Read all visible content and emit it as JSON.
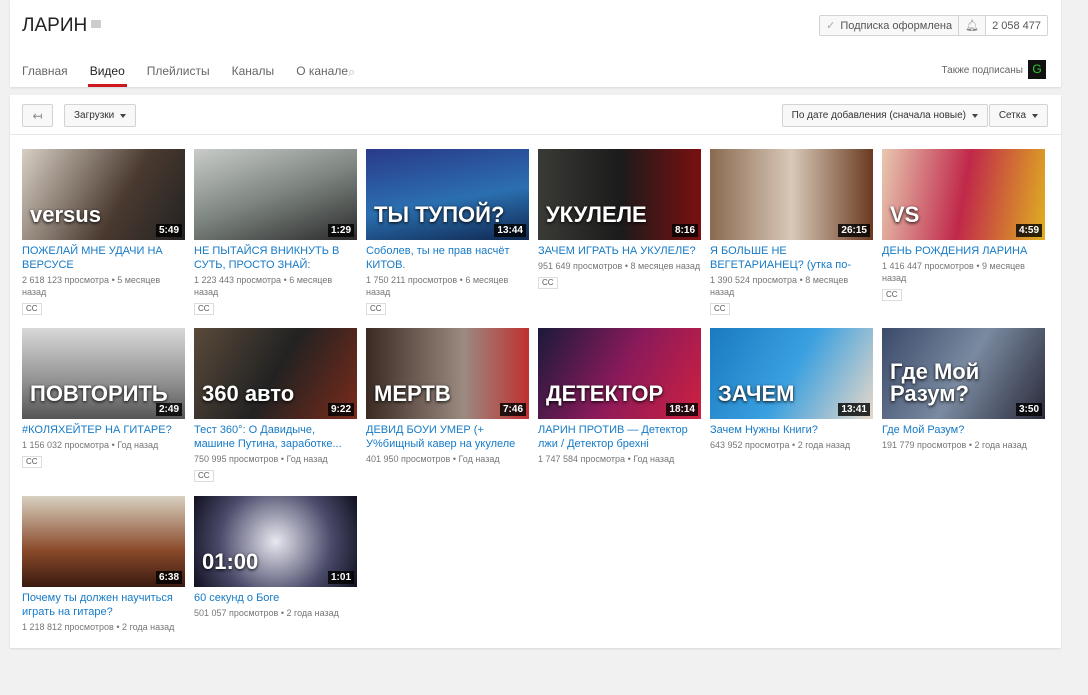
{
  "channel": {
    "title": "ЛАРИН",
    "subscribed_label": "Подписка оформлена",
    "subscriber_count": "2 058 477",
    "also_subscribed": "Также подписаны",
    "also_avatar": "G"
  },
  "tabs": [
    "Главная",
    "Видео",
    "Плейлисты",
    "Каналы",
    "О канале"
  ],
  "toolbar": {
    "uploads": "Загрузки",
    "sort": "По дате добавления (сначала новые)",
    "view": "Сетка"
  },
  "rows": [
    [
      {
        "title": "ПОЖЕЛАЙ МНЕ УДАЧИ НА ВЕРСУСЕ",
        "views": "2 618 123 просмотра",
        "date": "5 месяцев назад",
        "duration": "5:49",
        "cc": "CC",
        "thumb_text": "versus",
        "bg": "linear-gradient(120deg,#d8cfc4,#4a3a30 60%,#222)"
      },
      {
        "title": "НЕ ПЫТАЙСЯ ВНИКНУТЬ В СУТЬ, ПРОСТО ЗНАЙ:",
        "views": "1 223 443 просмотра",
        "date": "6 месяцев назад",
        "duration": "1:29",
        "cc": "CC",
        "thumb_text": "",
        "bg": "linear-gradient(160deg,#c9ccc9,#7d8580 50%,#2a2a2a)"
      },
      {
        "title": "Соболев, ты не прав насчёт КИТОВ.",
        "views": "1 750 211 просмотров",
        "date": "6 месяцев назад",
        "duration": "13:44",
        "cc": "CC",
        "thumb_text": "ТЫ ТУПОЙ?",
        "bg": "linear-gradient(170deg,#2a3a8a,#2b6fb0 55%,#0f2850)"
      },
      {
        "title": "ЗАЧЕМ ИГРАТЬ НА УКУЛЕЛЕ?",
        "views": "951 649 просмотров",
        "date": "8 месяцев назад",
        "duration": "8:16",
        "cc": "CC",
        "thumb_text": "УКУЛЕЛЕ",
        "bg": "linear-gradient(90deg,#3a3a36,#1b1b1b 50%,#7a1010)"
      },
      {
        "title": "Я БОЛЬШЕ НЕ ВЕГЕТАРИАНЕЦ? (утка по-пекински) feat",
        "views": "1 390 524 просмотра",
        "date": "8 месяцев назад",
        "duration": "26:15",
        "cc": "CC",
        "thumb_text": "",
        "bg": "linear-gradient(90deg,#8a6a50,#d8c8b8 50%,#6a3a20)"
      },
      {
        "title": "ДЕНЬ РОЖДЕНИЯ ЛАРИНА",
        "views": "1 416 447 просмотров",
        "date": "9 месяцев назад",
        "duration": "4:59",
        "cc": "CC",
        "thumb_text": "VS",
        "bg": "linear-gradient(100deg,#e8c8b0,#c0284a 50%,#e0b020)"
      }
    ],
    [
      {
        "title": "#КОЛЯХЕЙТЕР НА ГИТАРЕ?",
        "views": "1 156 032 просмотра",
        "date": "Год назад",
        "duration": "2:49",
        "cc": "CC",
        "thumb_text": "ПОВТОРИТЬ",
        "bg": "linear-gradient(180deg,#d8d8d8,#909090 60%,#555)"
      },
      {
        "title": "Тест 360°: О Давидыче, машине Путина, заработке...",
        "views": "750 995 просмотров",
        "date": "Год назад",
        "duration": "9:22",
        "cc": "CC",
        "thumb_text": "360 авто",
        "bg": "linear-gradient(120deg,#5a4a3a,#222 50%,#7a2a1a)"
      },
      {
        "title": "ДЕВИД БОУИ УМЕР (+ У%бищный кавер на укулеле",
        "views": "401 950 просмотров",
        "date": "Год назад",
        "duration": "7:46",
        "cc": "",
        "thumb_text": "МЕРТВ",
        "bg": "linear-gradient(90deg,#3a2a22,#9a8a80 60%,#c03030)"
      },
      {
        "title": "ЛАРИН ПРОТИВ — Детектор лжи / Детектор брехні",
        "views": "1 747 584 просмотра",
        "date": "Год назад",
        "duration": "18:14",
        "cc": "",
        "thumb_text": "ДЕТЕКТОР",
        "bg": "linear-gradient(120deg,#1a1a3a,#8a1a5a 50%,#d02040)"
      },
      {
        "title": "Зачем Нужны Книги?",
        "views": "643 952 просмотра",
        "date": "2 года назад",
        "duration": "13:41",
        "cc": "",
        "thumb_text": "ЗАЧЕМ",
        "bg": "linear-gradient(120deg,#1a7ac0,#3aa0e0 50%,#e8d8c8)"
      },
      {
        "title": "Где Мой Разум?",
        "views": "191 779 просмотров",
        "date": "2 года назад",
        "duration": "3:50",
        "cc": "",
        "thumb_text": "Где Мой Разум?",
        "bg": "linear-gradient(120deg,#3a4a6a,#7a8aa0 50%,#2a2a3a)"
      }
    ],
    [
      {
        "title": "Почему ты должен научиться играть на гитаре?",
        "views": "1 218 812 просмотров",
        "date": "2 года назад",
        "duration": "6:38",
        "cc": "",
        "thumb_text": "",
        "bg": "linear-gradient(180deg,#d8d0c0,#8a4a2a 60%,#3a1a10)"
      },
      {
        "title": "60 секунд о Боге",
        "views": "501 057 просмотров",
        "date": "2 года назад",
        "duration": "1:01",
        "cc": "",
        "thumb_text": "01:00",
        "bg": "radial-gradient(circle,#e8e8f0,#4a4a6a 60%,#101020)"
      }
    ]
  ]
}
